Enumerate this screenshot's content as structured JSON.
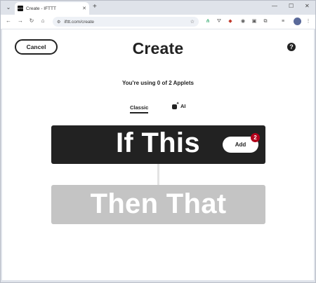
{
  "browser": {
    "tab_title": "Create - IFTTT",
    "tab_favicon_text": "IFTTT",
    "url": "ifttt.com/create"
  },
  "header": {
    "cancel_label": "Cancel",
    "title": "Create",
    "help_label": "?"
  },
  "applets_note": "You're using 0 of 2 Applets",
  "tabs": [
    {
      "label": "Classic",
      "active": true
    },
    {
      "label": "AI",
      "active": false
    }
  ],
  "if_card": {
    "text": "If This",
    "add_label": "Add",
    "badge_count": "2"
  },
  "then_card": {
    "text": "Then That"
  },
  "colors": {
    "primary": "#222222",
    "disabled": "#c4c4c4",
    "badge": "#b3001b"
  }
}
